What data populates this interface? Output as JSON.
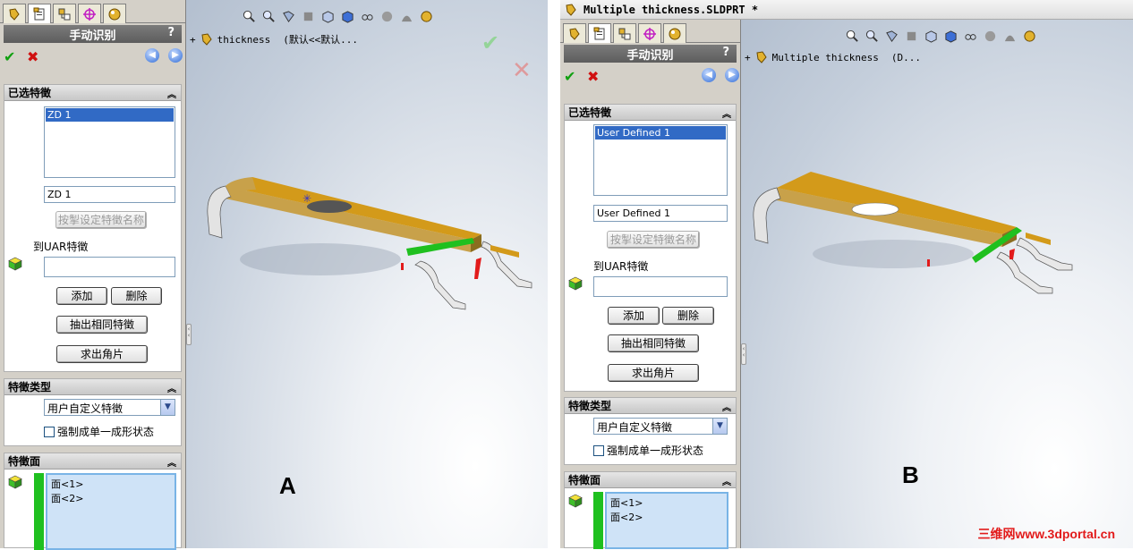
{
  "colors": {
    "accent_green": "#1fc01f",
    "ok_green": "#11a011",
    "cancel_red": "#d01010",
    "part_gold": "#d39a1a",
    "watermark_red": "#e21b1b"
  },
  "icons": {
    "tabs": [
      "feature-manager-icon",
      "property-manager-icon",
      "configuration-manager-icon",
      "dimxpert-icon",
      "display-manager-icon"
    ]
  },
  "shotA": {
    "panel": {
      "title": "手动识别",
      "help": "?",
      "selected_features": {
        "header": "已选特徵",
        "list_item": "ZD 1",
        "name_field": "ZD 1",
        "rename_button": "按掣设定特徵名称",
        "uar_label": "到UAR特徵",
        "uar_field": "",
        "add_button": "添加",
        "delete_button": "删除",
        "extract_button": "抽出相同特徵",
        "corner_button": "求出角片"
      },
      "feature_type": {
        "header": "特徵类型",
        "selected": "用户自定义特徵",
        "checkbox_label": "强制成单一成形状态"
      },
      "feature_faces": {
        "header": "特徵面",
        "faces": [
          "面<1>",
          "面<2>"
        ]
      }
    },
    "tree": {
      "expand": "+",
      "name": "thickness",
      "config": "(默认<<默认..."
    },
    "label": "A"
  },
  "shotB": {
    "window_title": "Multiple thickness.SLDPRT *",
    "panel": {
      "title": "手动识别",
      "help": "?",
      "selected_features": {
        "header": "已选特徵",
        "list_item": "User Defined 1",
        "name_field": "User Defined 1",
        "rename_button": "按掣设定特徵名称",
        "uar_label": "到UAR特徵",
        "uar_field": "",
        "add_button": "添加",
        "delete_button": "删除",
        "extract_button": "抽出相同特徵",
        "corner_button": "求出角片"
      },
      "feature_type": {
        "header": "特徵类型",
        "selected": "用户自定义特徵",
        "checkbox_label": "强制成单一成形状态"
      },
      "feature_faces": {
        "header": "特徵面",
        "faces": [
          "面<1>",
          "面<2>"
        ]
      }
    },
    "tree": {
      "expand": "+",
      "name": "Multiple thickness",
      "config": "(D..."
    },
    "label": "B"
  },
  "watermark": "三维网www.3dportal.cn"
}
